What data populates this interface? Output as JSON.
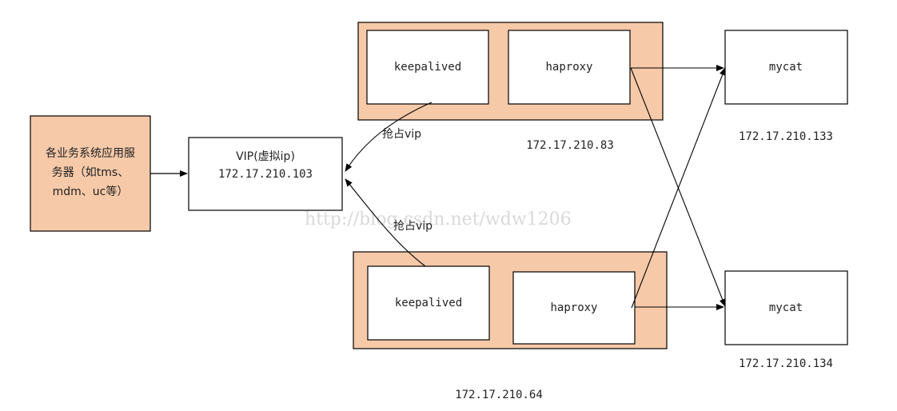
{
  "colors": {
    "host_fill": "#f6c9a8",
    "client_fill": "#f6c9a8",
    "box_fill": "#ffffff",
    "stroke": "#000000",
    "watermark": "#d9d9d9"
  },
  "client": {
    "line1": "各业务系统应用服",
    "line2": "务器（如tms、",
    "line3": "mdm、uc等）"
  },
  "vip": {
    "line1": "VIP(虚拟ip)",
    "line2": "172.17.210.103"
  },
  "host_top": {
    "keepalived": "keepalived",
    "haproxy": "haproxy",
    "ip": "172.17.210.83",
    "seize": "抢占vip"
  },
  "host_bottom": {
    "keepalived": "keepalived",
    "haproxy": "haproxy",
    "ip": "172.17.210.64",
    "seize": "抢占vip"
  },
  "mycat_top": {
    "name": "mycat",
    "ip": "172.17.210.133"
  },
  "mycat_bottom": {
    "name": "mycat",
    "ip": "172.17.210.134"
  },
  "watermark": "http://blog.csdn.net/wdw1206"
}
